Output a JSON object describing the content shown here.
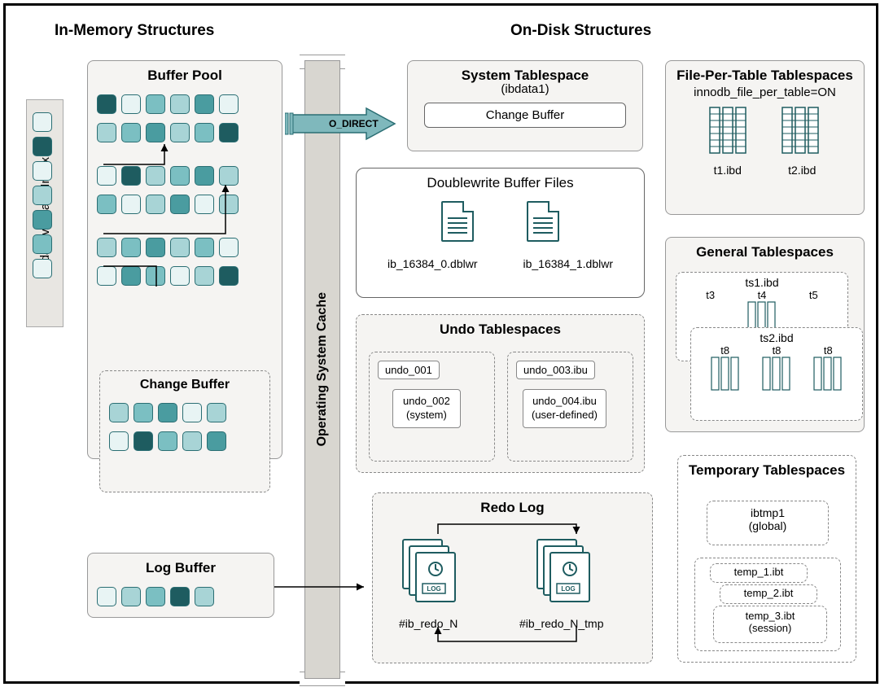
{
  "headers": {
    "inmem": "In-Memory Structures",
    "ondisk": "On-Disk Structures"
  },
  "adaptive_hash": "Adaptive Hash Index",
  "buffer_pool": {
    "title": "Buffer Pool",
    "change_buffer": "Change Buffer"
  },
  "os_cache": "Operating System Cache",
  "o_direct": "O_DIRECT",
  "log_buffer": "Log Buffer",
  "system_ts": {
    "title": "System Tablespace",
    "sub": "(ibdata1)",
    "change_buffer": "Change Buffer"
  },
  "dblwr": {
    "title": "Doublewrite Buffer Files",
    "f1": "ib_16384_0.dblwr",
    "f2": "ib_16384_1.dblwr"
  },
  "undo": {
    "title": "Undo Tablespaces",
    "u1": "undo_001",
    "u2": "undo_002",
    "u2s": "(system)",
    "u3": "undo_003.ibu",
    "u4": "undo_004.ibu",
    "u4s": "(user-defined)"
  },
  "redo": {
    "title": "Redo Log",
    "r1": "#ib_redo_N",
    "r2": "#ib_redo_N_tmp"
  },
  "fpt": {
    "title": "File-Per-Table Tablespaces",
    "sub": "innodb_file_per_table=ON",
    "t1": "t1.ibd",
    "t2": "t2.ibd"
  },
  "general": {
    "title": "General Tablespaces",
    "ts1": "ts1.ibd",
    "ts2": "ts2.ibd",
    "t3": "t3",
    "t4": "t4",
    "t5": "t5",
    "t8a": "t8",
    "t8b": "t8",
    "t8c": "t8"
  },
  "temp": {
    "title": "Temporary Tablespaces",
    "g": "ibtmp1",
    "gs": "(global)",
    "s1": "temp_1.ibt",
    "s2": "temp_2.ibt",
    "s3": "temp_3.ibt",
    "ss": "(session)"
  }
}
